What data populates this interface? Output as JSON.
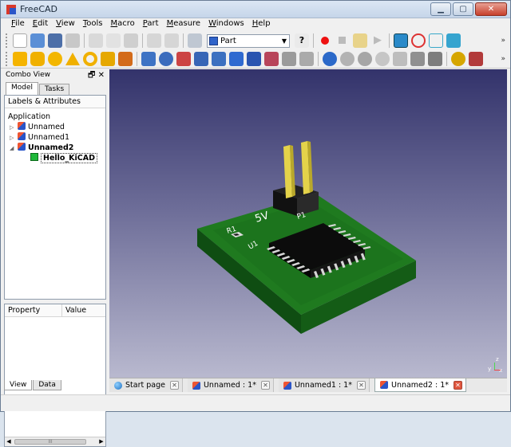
{
  "window": {
    "title": "FreeCAD",
    "controls": {
      "minimize": "▁",
      "maximize": "▢",
      "close": "✕"
    }
  },
  "menu": [
    "File",
    "Edit",
    "View",
    "Tools",
    "Macro",
    "Part",
    "Measure",
    "Windows",
    "Help"
  ],
  "toolbar": {
    "workbench_value": "Part",
    "overflow": "»"
  },
  "combo_view": {
    "title": "Combo View",
    "title_controls": "🗗 ✕",
    "tabs": [
      "Model",
      "Tasks"
    ],
    "tree_header": "Labels & Attributes",
    "root": "Application",
    "documents": [
      {
        "label": "Unnamed",
        "expanded": false
      },
      {
        "label": "Unnamed1",
        "expanded": false
      },
      {
        "label": "Unnamed2",
        "expanded": true
      }
    ],
    "child": "Hello_KiCAD",
    "property_columns": [
      "Property",
      "Value"
    ],
    "scroll_mark": "III",
    "bottom_tabs": [
      "View",
      "Data"
    ]
  },
  "viewer": {
    "silkscreen": [
      "5V",
      "P1",
      "R1",
      "U1"
    ],
    "axis_labels": [
      "y",
      "z",
      "x"
    ]
  },
  "doc_tabs": [
    {
      "label": "Start page",
      "active": false
    },
    {
      "label": "Unnamed : 1*",
      "active": false
    },
    {
      "label": "Unnamed1 : 1*",
      "active": false
    },
    {
      "label": "Unnamed2 : 1*",
      "active": true
    }
  ],
  "colors": {
    "background_top": "#33336b",
    "background_bottom": "#b9b9cf",
    "pcb": "#1f7a1f",
    "pin": "#e4d34a"
  }
}
